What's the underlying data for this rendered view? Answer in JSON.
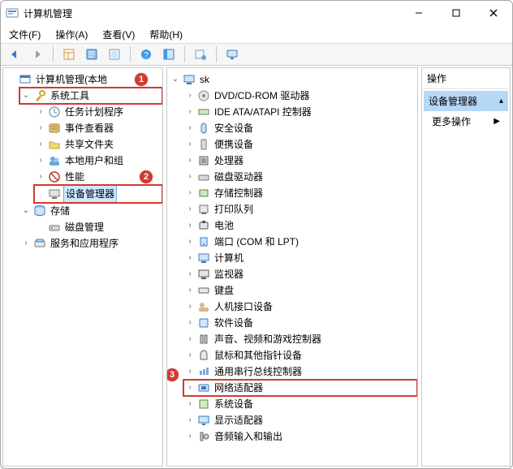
{
  "window": {
    "title": "计算机管理"
  },
  "window_buttons": {
    "min": "–",
    "max": "▢",
    "close": "✕"
  },
  "menus": {
    "file": "文件(F)",
    "action": "操作(A)",
    "view": "查看(V)",
    "help": "帮助(H)"
  },
  "toolbar": {
    "back": "←",
    "forward": "→",
    "up": "",
    "props": "",
    "help": "?"
  },
  "left_tree": {
    "root": "计算机管理(本地",
    "sys_tools": "系统工具",
    "task_sched": "任务计划程序",
    "event_viewer": "事件查看器",
    "shared": "共享文件夹",
    "users": "本地用户和组",
    "perf": "性能",
    "devmgr": "设备管理器",
    "storage": "存储",
    "diskmgmt": "磁盘管理",
    "services_apps": "服务和应用程序"
  },
  "center_tree": {
    "root": "sk",
    "items": [
      "DVD/CD-ROM 驱动器",
      "IDE ATA/ATAPI 控制器",
      "安全设备",
      "便携设备",
      "处理器",
      "磁盘驱动器",
      "存储控制器",
      "打印队列",
      "电池",
      "端口 (COM 和 LPT)",
      "计算机",
      "监视器",
      "键盘",
      "人机接口设备",
      "软件设备",
      "声音、视频和游戏控制器",
      "鼠标和其他指针设备",
      "通用串行总线控制器",
      "网络适配器",
      "系统设备",
      "显示适配器",
      "音频输入和输出"
    ],
    "highlighted": "网络适配器"
  },
  "right_pane": {
    "header": "操作",
    "section_title": "设备管理器",
    "more_actions": "更多操作"
  },
  "badges": {
    "b1": "1",
    "b2": "2",
    "b3": "3"
  }
}
